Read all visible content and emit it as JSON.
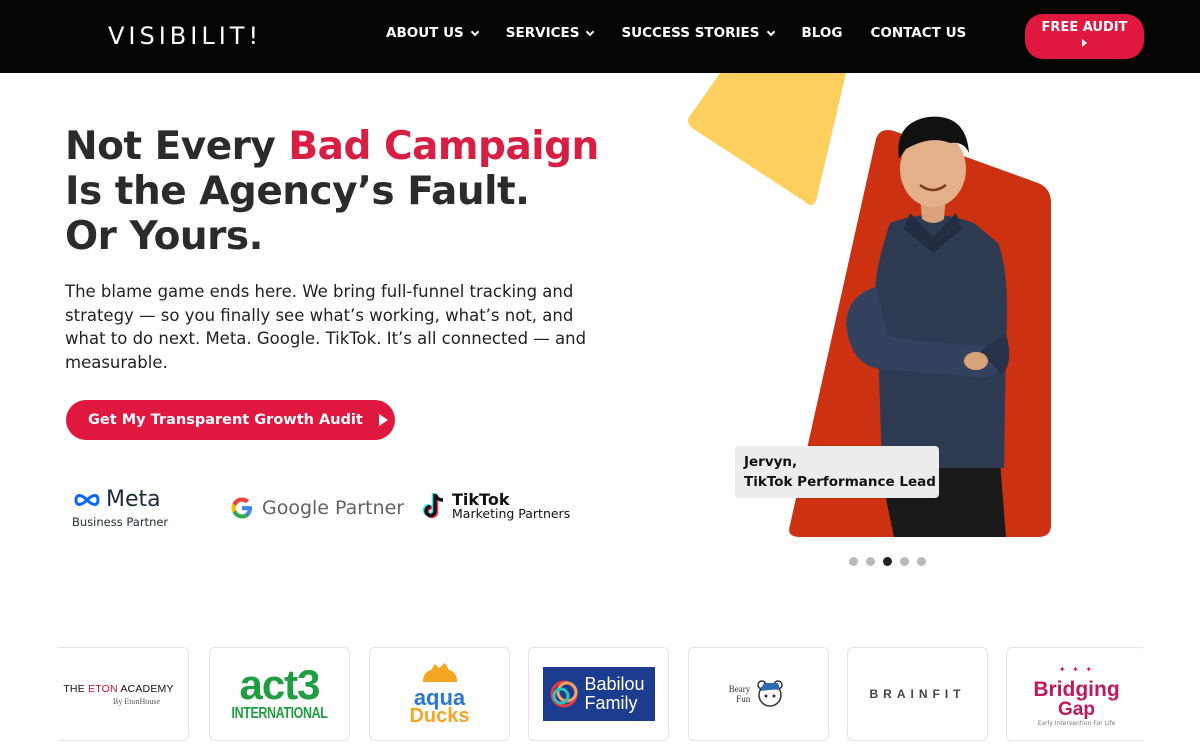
{
  "header": {
    "logo": "VISIBILIT!",
    "nav": [
      {
        "label": "ABOUT US",
        "dropdown": true
      },
      {
        "label": "SERVICES",
        "dropdown": true
      },
      {
        "label": "SUCCESS STORIES",
        "dropdown": true
      },
      {
        "label": "BLOG",
        "dropdown": false
      },
      {
        "label": "CONTACT US",
        "dropdown": false
      }
    ],
    "cta_label": "FREE AUDIT"
  },
  "hero": {
    "title_part1": "Not Every ",
    "title_accent": "Bad Campaign",
    "title_line2": "Is the Agency’s Fault.",
    "title_line3": "Or Yours.",
    "description": "The blame game ends here. We bring full-funnel tracking and strategy — so you finally see what’s working, what’s not, and what to do next. Meta. Google. TikTok. It’s all connected — and measurable.",
    "cta_label": "Get My Transparent Growth Audit",
    "caption_name": "Jervyn,",
    "caption_role": "TikTok Performance Lead"
  },
  "partners": {
    "meta_name": "Meta",
    "meta_sub": "Business Partner",
    "google": "Google Partner",
    "tiktok_name": "TikTok",
    "tiktok_sub": "Marketing Partners"
  },
  "carousel": {
    "count": 5,
    "active_index": 2
  },
  "clients": {
    "eton_a": "THE ",
    "eton_b": "ETON",
    "eton_c": " ACADEMY",
    "eton_sub": "By EtonHouse",
    "act3_a": "act3",
    "act3_b": "INTERNATIONAL",
    "aqua_a": "aqua",
    "aqua_b": "Ducks",
    "babilou_a": "Babilou",
    "babilou_b": "Family",
    "beary_a": "Beary",
    "beary_b": "Fun",
    "brainfit": "BRAINFIT",
    "bridging_a": "Bridging",
    "bridging_b": "Gap",
    "bridging_sub": "Early Intervention For Life"
  },
  "colors": {
    "brand_red": "#e0183f",
    "accent_text": "#d81e42",
    "header_bg": "#050505",
    "hero_shape_red": "#cc3211",
    "hero_shape_yellow": "#fdcf5e"
  }
}
